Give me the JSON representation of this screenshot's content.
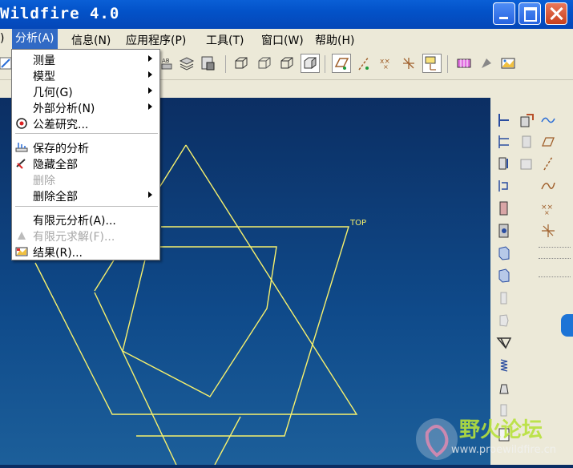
{
  "window": {
    "title": "Wildfire 4.0"
  },
  "menubar": {
    "items": [
      {
        "label": ")"
      },
      {
        "label": "分析(A)"
      },
      {
        "label": "信息(N)"
      },
      {
        "label": "应用程序(P)"
      },
      {
        "label": "工具(T)"
      },
      {
        "label": "窗口(W)"
      },
      {
        "label": "帮助(H)"
      }
    ]
  },
  "analysis_menu": {
    "items": [
      {
        "label": "测量",
        "submenu": true,
        "enabled": true
      },
      {
        "label": "模型",
        "submenu": true,
        "enabled": true
      },
      {
        "label": "几何(G)",
        "submenu": true,
        "enabled": true
      },
      {
        "label": "外部分析(N)",
        "submenu": true,
        "enabled": true
      },
      {
        "label": "公差研究...",
        "submenu": false,
        "enabled": true,
        "icon": "tolerance-icon"
      },
      {
        "label": "保存的分析",
        "submenu": false,
        "enabled": true,
        "icon": "saved-analysis-icon"
      },
      {
        "label": "隐藏全部",
        "submenu": false,
        "enabled": true,
        "icon": "hide-all-icon"
      },
      {
        "label": "删除",
        "submenu": false,
        "enabled": false
      },
      {
        "label": "删除全部",
        "submenu": true,
        "enabled": true
      },
      {
        "label": "有限元分析(A)...",
        "submenu": false,
        "enabled": true
      },
      {
        "label": "有限元求解(F)...",
        "submenu": false,
        "enabled": false,
        "icon": "fem-solve-icon"
      },
      {
        "label": "结果(R)...",
        "submenu": false,
        "enabled": true,
        "icon": "results-icon"
      }
    ]
  },
  "graphics": {
    "datum_label": "TOP"
  },
  "watermark": {
    "brand": "野火论坛",
    "url": "www.proewildfire.cn"
  },
  "colors": {
    "title_blue": "#0352c8",
    "menu_highlight": "#316ac5",
    "sketch_yellow": "#f7f16d",
    "background_top": "#0b2c60",
    "background_bottom": "#1c5f9a"
  }
}
